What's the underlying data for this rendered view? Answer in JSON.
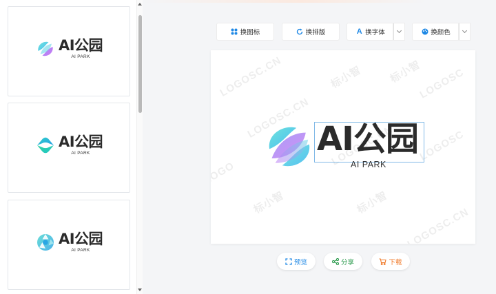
{
  "templates": [
    {
      "name": "AI公园",
      "sub": "AI PARK"
    },
    {
      "name": "AI公园",
      "sub": "AI PARK"
    },
    {
      "name": "AI公园",
      "sub": "AI PARK"
    }
  ],
  "toolbar": {
    "change_icon": "换图标",
    "change_layout": "换排版",
    "change_font": "换字体",
    "change_color": "换颜色"
  },
  "preview": {
    "brand_name": "AI公园",
    "brand_sub": "AI PARK",
    "watermarks": [
      "LOGOSC.CN",
      "标小智",
      "LOGOSC",
      "LOGOSC.CN",
      "标小智",
      "LOGOSC",
      "标小智",
      "LOGOSC.CN",
      "标小智",
      "LOGOSC.CN",
      "LOGO"
    ]
  },
  "actions": {
    "preview": "预览",
    "share": "分享",
    "download": "下载"
  },
  "colors": {
    "accent_blue": "#1e88e5",
    "share_green": "#2e9b4f",
    "download_orange": "#f07a2a"
  }
}
